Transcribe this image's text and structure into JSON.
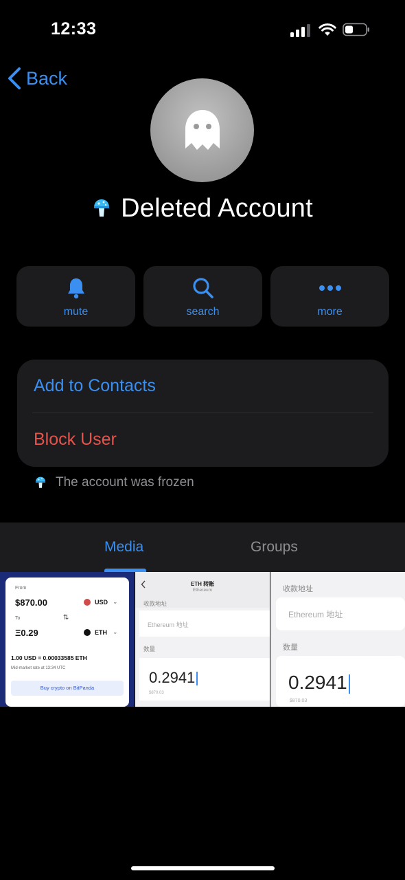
{
  "status_bar": {
    "time": "12:33",
    "icons": [
      "cellular-signal-icon",
      "wifi-icon",
      "battery-icon"
    ]
  },
  "nav": {
    "back_label": "Back"
  },
  "profile": {
    "avatar_icon": "ghost-icon",
    "badge_icon": "mushroom-icon",
    "name": "Deleted Account"
  },
  "actions": [
    {
      "label": "mute",
      "icon": "bell-icon"
    },
    {
      "label": "search",
      "icon": "search-icon"
    },
    {
      "label": "more",
      "icon": "ellipsis-icon"
    }
  ],
  "menu": {
    "add_contacts": "Add to Contacts",
    "block_user": "Block User"
  },
  "notice": {
    "icon": "mushroom-icon",
    "text": "The account was frozen"
  },
  "tabs": [
    {
      "label": "Media",
      "selected": true
    },
    {
      "label": "Groups",
      "selected": false
    }
  ],
  "media": {
    "thumb1": {
      "from_label": "From",
      "from_amount": "$870.00",
      "from_currency": "USD",
      "to_label": "To",
      "to_amount": "Ξ0.29",
      "to_currency": "ETH",
      "rate": "1.00 USD = 0.00033585 ETH",
      "mid_market": "Mid-market rate at 13:34 UTC",
      "buy_button": "Buy crypto on BitPanda"
    },
    "thumb2": {
      "title": "ETH 转账",
      "subtitle": "Ethereum",
      "address_label": "收款地址",
      "address_placeholder": "Ethereum 地址",
      "quantity_label": "数量",
      "quantity_value": "0.2941",
      "usd_value": "$870.03"
    },
    "thumb3": {
      "address_label": "收款地址",
      "address_placeholder": "Ethereum 地址",
      "quantity_label": "数量",
      "quantity_value": "0.2941",
      "usd_value": "$870.03"
    }
  },
  "colors": {
    "accent": "#3a8ff0",
    "destructive": "#e5534b",
    "background": "#000000",
    "card": "#1c1c1e",
    "secondary_text": "#8e8e93"
  }
}
